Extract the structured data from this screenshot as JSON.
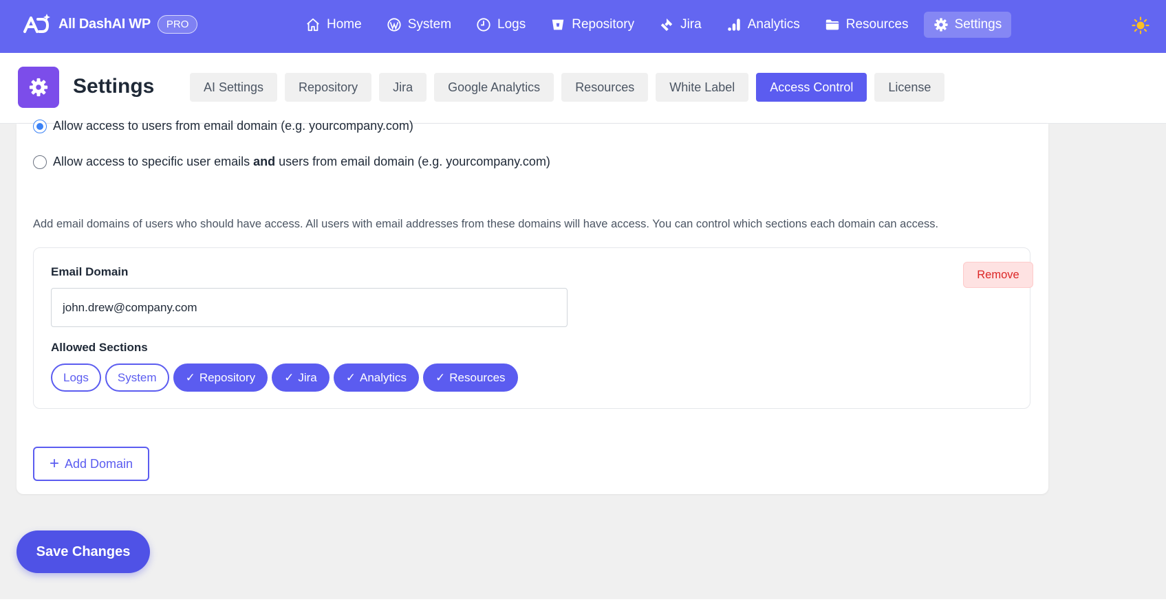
{
  "brand": {
    "name": "All DashAI WP",
    "badge": "PRO"
  },
  "nav": {
    "items": [
      {
        "label": "Home",
        "icon": "home-icon"
      },
      {
        "label": "System",
        "icon": "wordpress-icon"
      },
      {
        "label": "Logs",
        "icon": "clock-icon"
      },
      {
        "label": "Repository",
        "icon": "bitbucket-icon"
      },
      {
        "label": "Jira",
        "icon": "jira-icon"
      },
      {
        "label": "Analytics",
        "icon": "bar-chart-icon"
      },
      {
        "label": "Resources",
        "icon": "folder-icon"
      },
      {
        "label": "Settings",
        "icon": "gear-icon",
        "active": true
      }
    ],
    "theme_toggle_icon": "sun-icon"
  },
  "settings": {
    "title": "Settings",
    "tabs": [
      "AI Settings",
      "Repository",
      "Jira",
      "Google Analytics",
      "Resources",
      "White Label",
      "Access Control",
      "License"
    ],
    "active_tab": "Access Control"
  },
  "access": {
    "option1": "Allow access to users from email domain (e.g. yourcompany.com)",
    "option2_pre": "Allow access to specific user emails ",
    "option2_bold": "and",
    "option2_post": " users from email domain (e.g. yourcompany.com)",
    "selected_option": 1,
    "help_text": "Add email domains of users who should have access. All users with email addresses from these domains will have access. You can control which sections each domain can access.",
    "domain": {
      "label": "Email Domain",
      "value": "john.drew@company.com",
      "remove_label": "Remove",
      "sections_label": "Allowed Sections",
      "sections": [
        {
          "label": "Logs",
          "selected": false
        },
        {
          "label": "System",
          "selected": false
        },
        {
          "label": "Repository",
          "selected": true
        },
        {
          "label": "Jira",
          "selected": true
        },
        {
          "label": "Analytics",
          "selected": true
        },
        {
          "label": "Resources",
          "selected": true
        }
      ]
    },
    "add_domain_label": "Add Domain",
    "add_domain_icon": "+"
  },
  "save_label": "Save Changes",
  "colors": {
    "primary": "#6366f1",
    "accent": "#5b5cf0",
    "danger": "#dc2626",
    "settings_icon_bg": "#7c4dea"
  }
}
